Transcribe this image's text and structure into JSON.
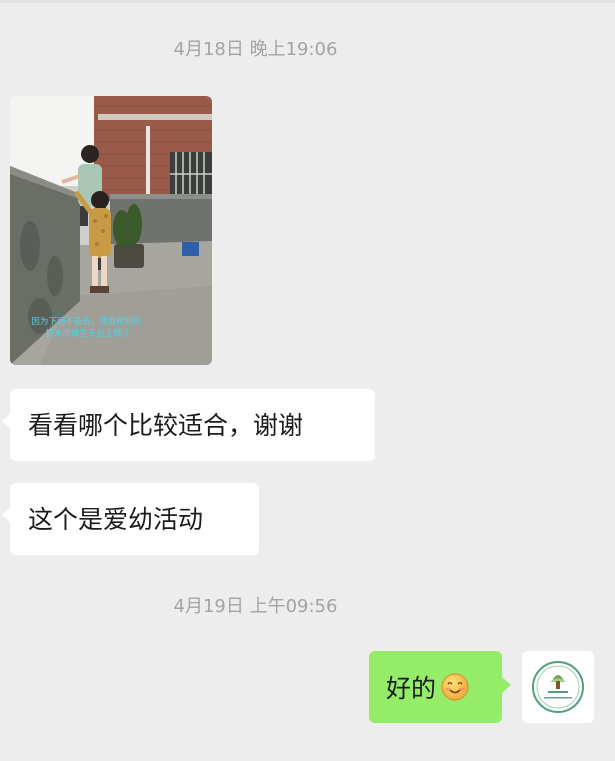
{
  "chat": {
    "timestamp_1": "4月18日 晚上19:06",
    "timestamp_2": "4月19日 上午09:56",
    "photo_caption": "因为下雨不能去，我就帮奶奶把东西放在天台上晒了。",
    "message_1": "看看哪个比较适合，谢谢",
    "message_2": "这个是爱幼活动",
    "reply": "好的",
    "reply_emoji": "smile-emoji-icon"
  },
  "colors": {
    "background": "#ededed",
    "bubble_incoming": "#ffffff",
    "bubble_outgoing": "#95ec69",
    "timestamp_text": "#a3a3a3"
  }
}
